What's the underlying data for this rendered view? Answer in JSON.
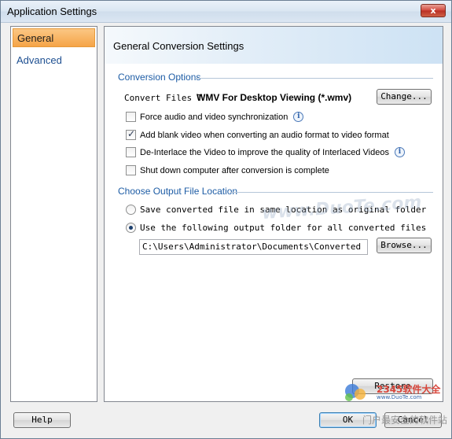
{
  "window": {
    "title": "Application Settings",
    "close_label": "x"
  },
  "sidebar": {
    "items": [
      {
        "label": "General"
      },
      {
        "label": "Advanced"
      }
    ]
  },
  "content": {
    "header": "General Conversion Settings",
    "conversion_options": {
      "title": "Conversion Options",
      "convert_label": "Convert Files T",
      "format_value": "WMV For Desktop Viewing (*.wmv)",
      "change_label": "Change...",
      "checkboxes": [
        {
          "label": "Force audio and video synchronization",
          "checked": false,
          "info": true
        },
        {
          "label": "Add blank video when converting an audio format to video format",
          "checked": true,
          "info": false
        },
        {
          "label": "De-Interlace the Video to improve the quality of Interlaced Videos",
          "checked": false,
          "info": true
        },
        {
          "label": "Shut down computer after conversion is complete",
          "checked": false,
          "info": false
        }
      ]
    },
    "output_location": {
      "title": "Choose Output File Location",
      "radios": [
        {
          "label": "Save converted file in same location as original folder",
          "checked": false
        },
        {
          "label": "Use the following output folder for all converted files",
          "checked": true
        }
      ],
      "folder_path": "C:\\Users\\Administrator\\Documents\\Converted",
      "browse_label": "Browse..."
    },
    "restore_label": "Restore"
  },
  "footer": {
    "help_label": "Help",
    "ok_label": "OK",
    "cancel_label": "Cancel"
  },
  "watermark": {
    "main": "www.DuoTe.com",
    "logo_big": "2345软件大全",
    "logo_small": "www.DuoTe.com",
    "bottom": "门户最安全的软件站"
  }
}
